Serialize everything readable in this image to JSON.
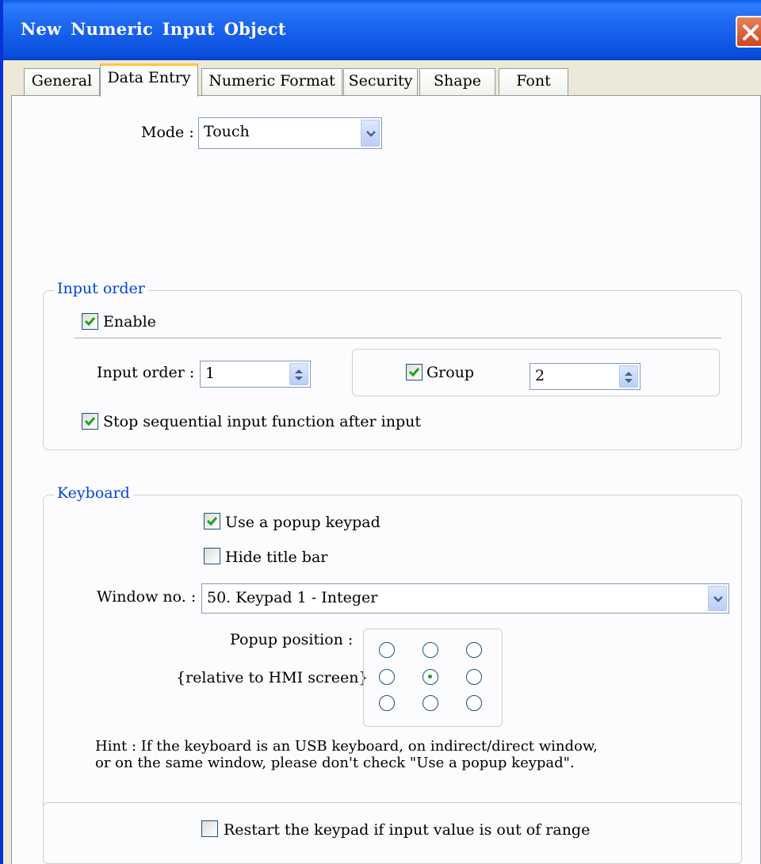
{
  "window": {
    "title": "New  Numeric Input Object"
  },
  "tabs": [
    {
      "label": "General"
    },
    {
      "label": "Data Entry"
    },
    {
      "label": "Numeric Format"
    },
    {
      "label": "Security"
    },
    {
      "label": "Shape"
    },
    {
      "label": "Font"
    }
  ],
  "active_tab": "Data Entry",
  "mode": {
    "label": "Mode :",
    "value": "Touch"
  },
  "input_order": {
    "legend": "Input order",
    "enable_label": "Enable",
    "enable_checked": true,
    "order_label": "Input order :",
    "order_value": "1",
    "group_label": "Group",
    "group_checked": true,
    "group_value": "2",
    "stop_label": "Stop sequential input function after input",
    "stop_checked": true
  },
  "keyboard": {
    "legend": "Keyboard",
    "popup_label": "Use a popup keypad",
    "popup_checked": true,
    "hide_title_label": "Hide title bar",
    "hide_title_checked": false,
    "window_label": "Window no. :",
    "window_value": "50. Keypad 1 - Integer",
    "position_label": "Popup position :",
    "position_sub": "{relative to HMI screen}",
    "position_selected": "middle-center",
    "hint_line1": "Hint : If the keyboard is an USB keyboard, on indirect/direct window,",
    "hint_line2": "or on the same window, please don't check \"Use a popup keypad\"."
  },
  "restart": {
    "label": "Restart the keypad if input value is out of range",
    "checked": false
  },
  "colors": {
    "title_blue": "#0a4fdd",
    "legend_blue": "#0046d5",
    "check_green": "#21a121"
  }
}
